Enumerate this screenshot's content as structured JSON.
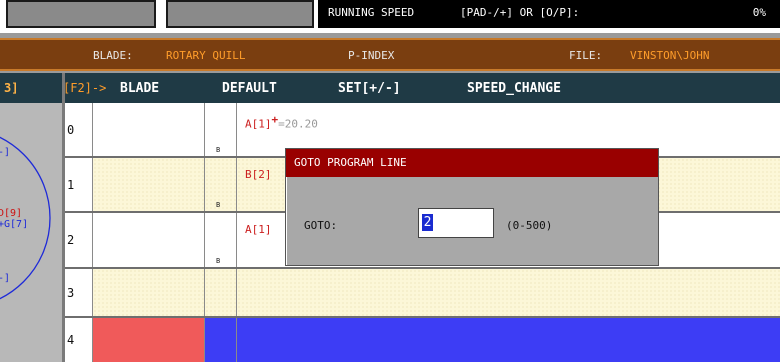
{
  "status": {
    "running_speed_label": "RUNNING SPEED",
    "speed_hint": "[PAD-/+] OR [O/P]:",
    "speed_value": "0%"
  },
  "info_bar": {
    "blade_label": "BLADE:",
    "blade_value": "ROTARY QUILL",
    "pindex_label": "P-INDEX",
    "file_label": "FILE:",
    "file_value": "VINSTON\\JOHN"
  },
  "left_panel": {
    "tab_label": "3]",
    "labels": [
      "-]",
      "D[9]",
      "+G[7]",
      "-]"
    ]
  },
  "header": {
    "f2": "[F2]->",
    "blade": "BLADE",
    "default": "DEFAULT",
    "set": "SET[+/-]",
    "speed_change": "SPEED_CHANGE"
  },
  "rows": [
    {
      "num": "0",
      "flag": "B",
      "instr_main": "A[1]",
      "instr_sup": "+",
      "instr_rest": "=20.20"
    },
    {
      "num": "1",
      "flag": "B",
      "instr_main": "B[2]",
      "instr_sup": "",
      "instr_rest": ""
    },
    {
      "num": "2",
      "flag": "B",
      "instr_main": "A[1]",
      "instr_sup": "",
      "instr_rest": ""
    },
    {
      "num": "3",
      "flag": "",
      "instr_main": "",
      "instr_sup": "",
      "instr_rest": ""
    },
    {
      "num": "4",
      "flag": "",
      "instr_main": "",
      "instr_sup": "",
      "instr_rest": ""
    }
  ],
  "dialog": {
    "title": "GOTO PROGRAM LINE",
    "goto_label": "GOTO:",
    "goto_value": "2",
    "range": "(0-500)"
  },
  "colors": {
    "dialog_title_bg": "#990000",
    "row4_cell_red": "#f05a5a",
    "row4_blue": "#3d3df5"
  }
}
